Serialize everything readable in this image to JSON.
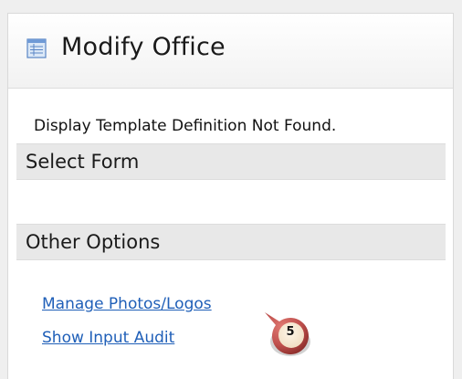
{
  "header": {
    "title": "Modify Office",
    "icon": "form-icon"
  },
  "main": {
    "message": "Display Template Definition Not Found.",
    "sections": [
      {
        "label": "Select Form"
      },
      {
        "label": "Other Options"
      }
    ],
    "links": [
      {
        "label": "Manage Photos/Logos"
      },
      {
        "label": "Show Input Audit"
      }
    ]
  },
  "callout": {
    "number": "5",
    "color": "#c0504d"
  },
  "colors": {
    "link": "#1f5fb8",
    "section_bg": "#e8e8e8"
  }
}
